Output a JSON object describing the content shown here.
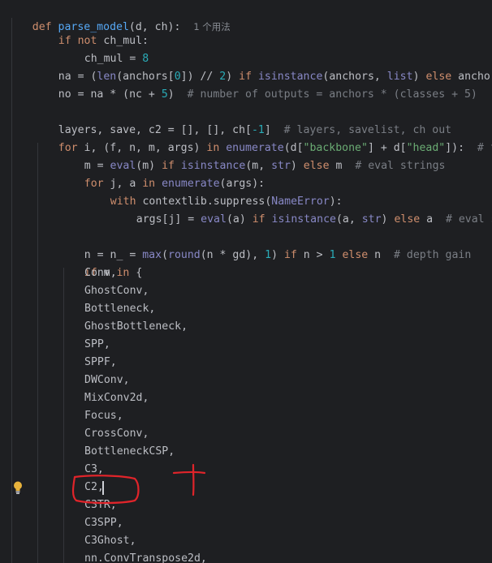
{
  "lines": {
    "l0": {
      "kw": "def",
      "fn": "parse_model",
      "rest": "(d, ch):",
      "hint": "1 个用法"
    },
    "l1": {
      "kw1": "if",
      "kw2": "not",
      "rest": "ch_mul:"
    },
    "l2": {
      "a": "ch_mul = ",
      "num": "8"
    },
    "l3": {
      "a": "na = (",
      "bi1": "len",
      "b": "(anchors[",
      "num0": "0",
      "c": "]) // ",
      "num2": "2",
      "d": ") ",
      "kw_if": "if",
      "e": " ",
      "bi2": "isinstance",
      "f": "(anchors, ",
      "bi3": "list",
      "g": ") ",
      "kw_else": "else",
      "h": " anchors"
    },
    "l4": {
      "a": "no = na * (nc + ",
      "num": "5",
      "b": ")  ",
      "cm": "# number of outputs = anchors * (classes + 5)"
    },
    "l5": {
      "a": "layers, save, c2 = [], [], ch[",
      "num": "-1",
      "b": "]  ",
      "cm": "# layers, savelist, ch out"
    },
    "l6": {
      "kw_for": "for",
      "a": " i, (f, n, m, args) ",
      "kw_in": "in",
      "b": " ",
      "bi": "enumerate",
      "c": "(d[",
      "str1": "\"backbone\"",
      "d": "] + d[",
      "str2": "\"head\"",
      "e": "]):  ",
      "cm": "# from"
    },
    "l7": {
      "a": "m = ",
      "bi1": "eval",
      "b": "(m) ",
      "kw_if": "if",
      "c": " ",
      "bi2": "isinstance",
      "d": "(m, ",
      "bi3": "str",
      "e": ") ",
      "kw_else": "else",
      "f": " m  ",
      "cm": "# eval strings"
    },
    "l8": {
      "kw_for": "for",
      "a": " j, a ",
      "kw_in": "in",
      "b": " ",
      "bi": "enumerate",
      "c": "(args):"
    },
    "l9": {
      "kw_with": "with",
      "a": " contextlib.suppress(",
      "bi": "NameError",
      "b": "):"
    },
    "l10": {
      "a": "args[j] = ",
      "bi1": "eval",
      "b": "(a) ",
      "kw_if": "if",
      "c": " ",
      "bi2": "isinstance",
      "d": "(a, ",
      "bi3": "str",
      "e": ") ",
      "kw_else": "else",
      "f": " a  ",
      "cm": "# eval stri"
    },
    "l11": {
      "a": "n = n_ = ",
      "bi1": "max",
      "b": "(",
      "bi2": "round",
      "c": "(n * gd), ",
      "num1": "1",
      "d": ") ",
      "kw_if": "if",
      "e": " n > ",
      "num2": "1",
      "f": " ",
      "kw_else": "else",
      "g": " n  ",
      "cm": "# depth gain"
    },
    "l12": {
      "kw_if": "if",
      "a": " m ",
      "kw_in": "in",
      "b": " {"
    }
  },
  "modules": [
    "Conv,",
    "GhostConv,",
    "Bottleneck,",
    "GhostBottleneck,",
    "SPP,",
    "SPPF,",
    "DWConv,",
    "MixConv2d,",
    "Focus,",
    "CrossConv,",
    "BottleneckCSP,",
    "C3,",
    "C2,",
    "C3TR,",
    "C3SPP,",
    "C3Ghost,",
    "nn.ConvTranspose2d,"
  ],
  "colors": {
    "background": "#1e1f22",
    "keyword": "#cf8e6d",
    "function": "#56a8f5",
    "builtin": "#8888c6",
    "number": "#2aacb8",
    "string": "#6aab73",
    "comment": "#7a7e85",
    "annotation": "#e0242a"
  },
  "icons": {
    "gutter": "lightbulb-icon"
  }
}
